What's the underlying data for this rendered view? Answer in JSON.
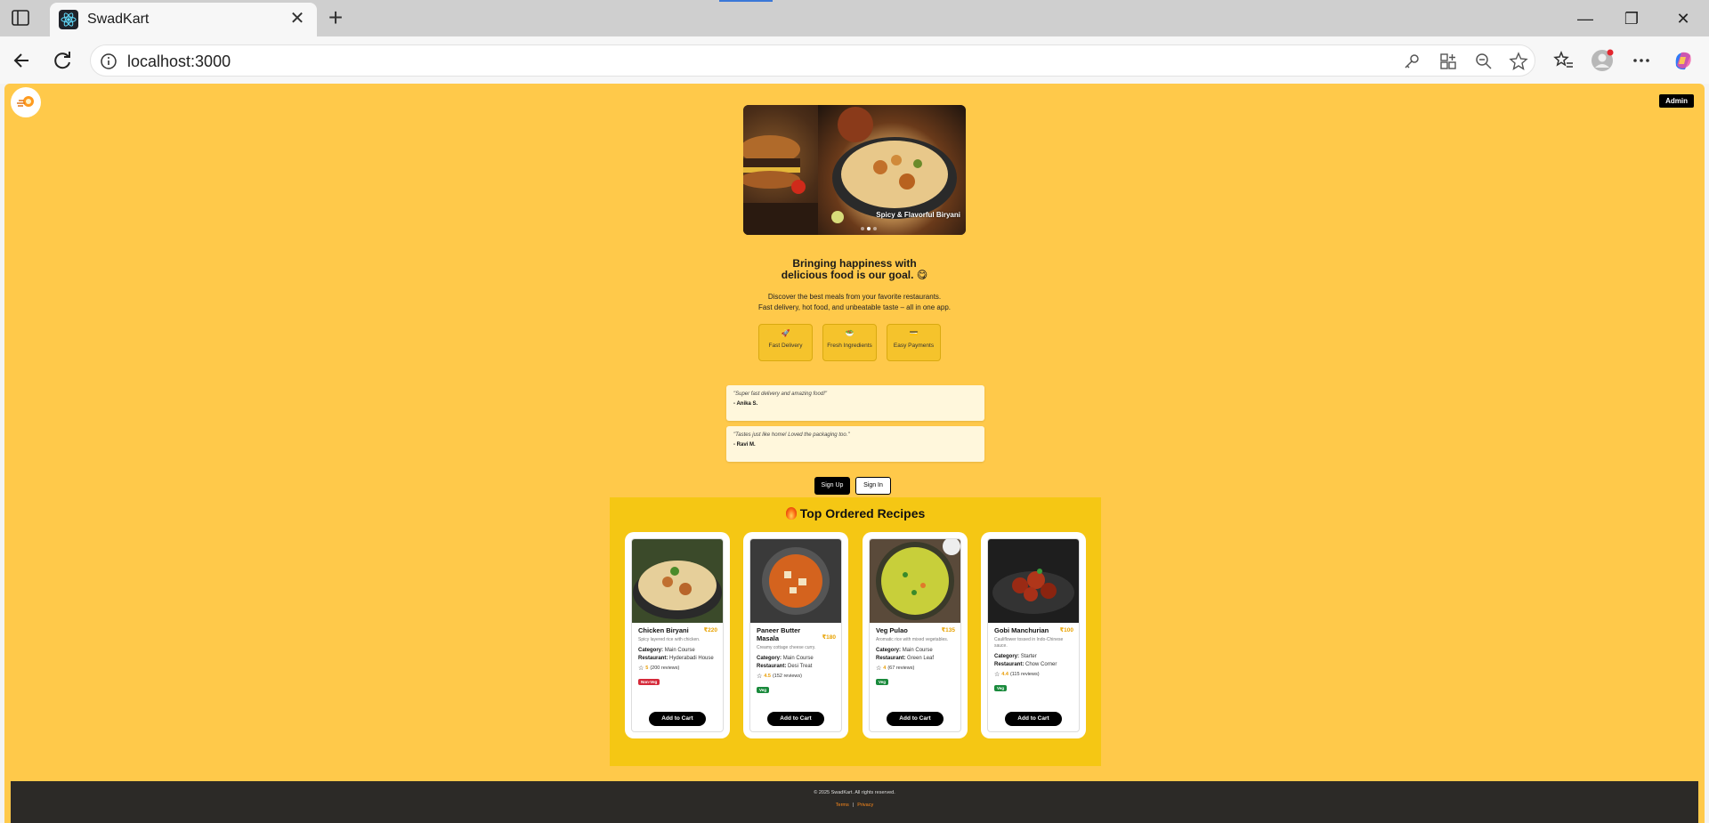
{
  "browser": {
    "tab_title": "SwadKart",
    "url": "localhost:3000"
  },
  "page": {
    "admin_label": "Admin",
    "carousel": {
      "caption": "Spicy & Flavorful Biryani",
      "slide_count": 3,
      "active_slide": 2
    },
    "headline_line1": "Bringing happiness with",
    "headline_line2": "delicious food is our goal. 😋",
    "subtext_line1": "Discover the best meals from your favorite restaurants.",
    "subtext_line2": "Fast delivery, hot food, and unbeatable taste – all in one app.",
    "features": [
      {
        "icon": "🚀",
        "label": "Fast Delivery"
      },
      {
        "icon": "🥗",
        "label": "Fresh Ingredients"
      },
      {
        "icon": "💳",
        "label": "Easy Payments"
      }
    ],
    "testimonials": [
      {
        "quote": "\"Super fast delivery and amazing food!\"",
        "author": "- Anika S."
      },
      {
        "quote": "\"Tastes just like home! Loved the packaging too.\"",
        "author": "- Ravi M."
      }
    ],
    "signup_label": "Sign Up",
    "signin_label": "Sign In",
    "recipes_title": "Top Ordered Recipes",
    "recipes": [
      {
        "name": "Chicken Biryani",
        "price": "₹220",
        "desc": "Spicy layered rice with chicken.",
        "category": "Main Course",
        "restaurant": "Hyderabadi House",
        "rating": "5",
        "reviews": "(200 reviews)",
        "tag": "Non-Veg",
        "add_label": "Add to Cart"
      },
      {
        "name": "Paneer Butter Masala",
        "price": "₹180",
        "desc": "Creamy cottage cheese curry.",
        "category": "Main Course",
        "restaurant": "Desi Treat",
        "rating": "4.5",
        "reviews": "(152 reviews)",
        "tag": "Veg",
        "add_label": "Add to Cart"
      },
      {
        "name": "Veg Pulao",
        "price": "₹135",
        "desc": "Aromatic rice with mixed vegetables.",
        "category": "Main Course",
        "restaurant": "Green Leaf",
        "rating": "4",
        "reviews": "(67 reviews)",
        "tag": "Veg",
        "add_label": "Add to Cart"
      },
      {
        "name": "Gobi Manchurian",
        "price": "₹100",
        "desc": "Cauliflower tossed in Indo-Chinese sauce.",
        "category": "Starter",
        "restaurant": "Chow Corner",
        "rating": "4.4",
        "reviews": "(115 reviews)",
        "tag": "Veg",
        "add_label": "Add to Cart"
      }
    ],
    "labels": {
      "category": "Category:",
      "restaurant": "Restaurant:"
    },
    "footer": {
      "copyright": "© 2025 SwadKart. All rights reserved.",
      "terms": "Terms",
      "separator": "|",
      "privacy": "Privacy"
    }
  },
  "colors": {
    "page_bg": "#ffc94a",
    "section_bg": "#f5c714",
    "price": "#e8a200",
    "veg": "#1a8a3c",
    "non_veg": "#d52a3a",
    "footer_bg": "#2c2a27",
    "footer_link": "#ff8a1a"
  }
}
